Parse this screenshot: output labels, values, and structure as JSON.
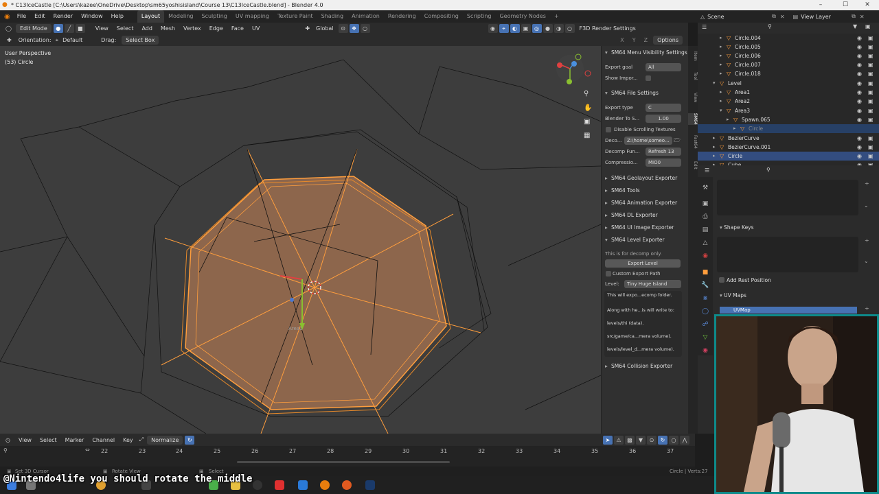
{
  "window": {
    "title": "* C13IceCastle [C:\\Users\\kazee\\OneDrive\\Desktop\\sm65yoshisisland\\Course 13\\C13IceCastle.blend] - Blender 4.0",
    "minimize": "–",
    "maximize": "☐",
    "close": "✕"
  },
  "menubar": {
    "items": [
      "File",
      "Edit",
      "Render",
      "Window",
      "Help"
    ],
    "workspaces": [
      "Layout",
      "Modeling",
      "Sculpting",
      "UV mapping",
      "Texture Paint",
      "Shading",
      "Animation",
      "Rendering",
      "Compositing",
      "Scripting",
      "Geometry Nodes",
      "+"
    ],
    "active_workspace": "Layout",
    "scene": "Scene",
    "view_layer": "View Layer"
  },
  "viewport_header": {
    "mode": "Edit Mode",
    "menus": [
      "View",
      "Select",
      "Add",
      "Mesh",
      "Vertex",
      "Edge",
      "Face",
      "UV"
    ],
    "transform_orientation": "Global",
    "render_settings": "F3D Render Settings",
    "orientation_label": "Orientation:",
    "orientation_value": "Default",
    "drag_label": "Drag:",
    "drag_value": "Select Box",
    "xyz": [
      "X",
      "Y",
      "Z"
    ],
    "options": "Options"
  },
  "viewport": {
    "perspective": "User Perspective",
    "object": "(53) Circle",
    "origin_label": "Area1"
  },
  "npanel": {
    "menu_visibility": "SM64 Menu Visibility Settings",
    "export_goal_label": "Export goal",
    "export_goal_value": "All",
    "show_import_label": "Show Impor...",
    "file_settings": "SM64 File Settings",
    "export_type_label": "Export type",
    "export_type_value": "C",
    "blender_scale_label": "Blender To S...",
    "blender_scale_value": "1.00",
    "disable_scrolling": "Disable Scrolling Textures",
    "decomp_label": "Deco...",
    "decomp_value": "Z:\\home\\someo...",
    "decomp_func_label": "Decomp Fun...",
    "decomp_func_value": "Refresh 13",
    "compression_label": "Compressio...",
    "compression_value": "MIO0",
    "sections": [
      "SM64 Geolayout Exporter",
      "SM64 Tools",
      "SM64 Animation Exporter",
      "SM64 DL Exporter",
      "SM64 UI Image Exporter"
    ],
    "level_exporter": "SM64 Level Exporter",
    "decomp_only": "This is for decomp only.",
    "export_level_btn": "Export Level",
    "custom_export_path": "Custom Export Path",
    "level_label": "Level:",
    "level_value": "Tiny Huge Island",
    "info_lines": [
      "This will expo...ecomp folder.",
      "Along with he...is will write to:",
      "levels/thi (data).",
      "src/game/ca...mera volume).",
      "levels/level_d...mera volume)."
    ],
    "collision_exporter": "SM64 Collision Exporter",
    "tabs": [
      "Item",
      "Tool",
      "View",
      "SM64",
      "Fast64",
      "Edit"
    ]
  },
  "outliner": {
    "rows": [
      {
        "name": "Circle.004",
        "indent": 3
      },
      {
        "name": "Circle.005",
        "indent": 3
      },
      {
        "name": "Circle.006",
        "indent": 3
      },
      {
        "name": "Circle.007",
        "indent": 3
      },
      {
        "name": "Circle.018",
        "indent": 3
      },
      {
        "name": "Level",
        "indent": 2
      },
      {
        "name": "Area1",
        "indent": 3
      },
      {
        "name": "Area2",
        "indent": 3
      },
      {
        "name": "Area3",
        "indent": 3
      },
      {
        "name": "Spawn.065",
        "indent": 4
      },
      {
        "name": "Circle",
        "indent": 5
      },
      {
        "name": "BezierCurve",
        "indent": 2
      },
      {
        "name": "BezierCurve.001",
        "indent": 2
      },
      {
        "name": "Circle",
        "indent": 2
      },
      {
        "name": "Cube",
        "indent": 2
      }
    ]
  },
  "properties": {
    "shape_keys": "Shape Keys",
    "add_rest_position": "Add Rest Position",
    "uv_maps": "UV Maps",
    "uv_map_item": "UVMap"
  },
  "timeline": {
    "menus": [
      "View",
      "Select",
      "Marker",
      "Channel",
      "Key"
    ],
    "normalize": "Normalize",
    "frames": [
      "22",
      "23",
      "24",
      "25",
      "26",
      "27",
      "28",
      "29",
      "30",
      "31",
      "32",
      "33",
      "34",
      "35",
      "36",
      "37"
    ]
  },
  "statusbar": {
    "set_cursor": "Set 3D Cursor",
    "rotate_view": "Rotate View",
    "select": "Select",
    "stats": "Circle | Verts:27"
  },
  "subtitle": "@Nintendo4life you should rotate the middle",
  "colors": {
    "accent_select": "#334d80",
    "mesh_selected": "#ff9e3d",
    "viewport_bg": "#3d3d3d",
    "webcam_border": "#0e8a8a"
  }
}
